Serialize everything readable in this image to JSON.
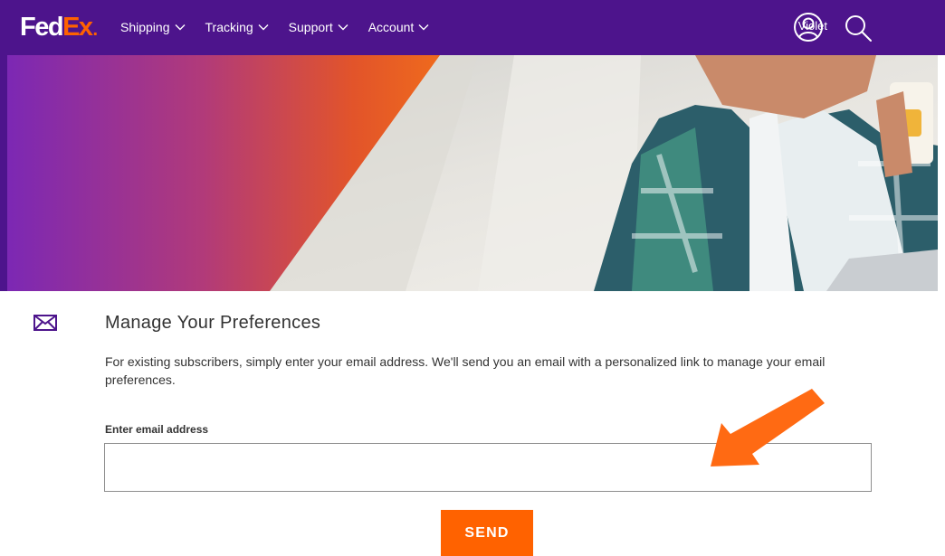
{
  "header": {
    "logo_fed": "Fed",
    "logo_ex": "Ex",
    "logo_dot": ".",
    "nav": [
      {
        "label": "Shipping"
      },
      {
        "label": "Tracking"
      },
      {
        "label": "Support"
      },
      {
        "label": "Account"
      }
    ],
    "user_name": "Violet",
    "icons": {
      "user": "user-circle-icon",
      "search": "search-icon",
      "chevron": "chevron-down-icon"
    }
  },
  "main": {
    "icon": "mail-icon",
    "title": "Manage Your Preferences",
    "description": "For existing subscribers, simply enter your email address. We'll send you an email with a personalized link to manage your email preferences.",
    "email_label": "Enter email address",
    "email_value": "",
    "email_placeholder": "",
    "send_label": "SEND"
  },
  "colors": {
    "brand_purple": "#4d148c",
    "brand_orange": "#ff6200",
    "annotation_arrow": "#ff6a13"
  }
}
